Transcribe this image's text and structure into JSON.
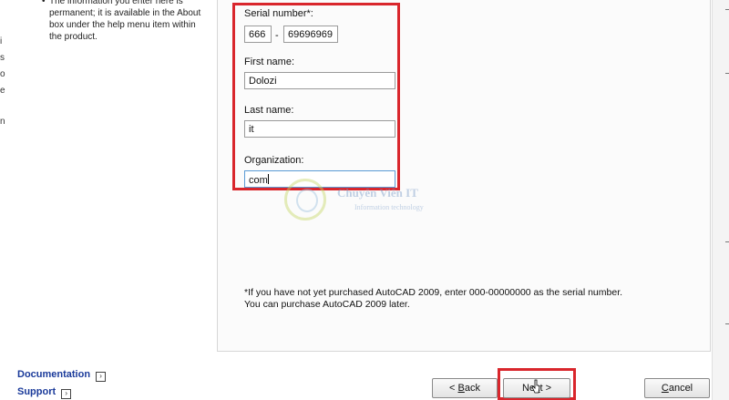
{
  "sidebar": {
    "note_text": "The information you enter here is permanent; it is available in the About box under the help menu item within the product."
  },
  "form": {
    "serial_label": "Serial number*:",
    "serial_prefix": "666",
    "serial_separator": "-",
    "serial_number": "69696969",
    "first_name_label": "First name:",
    "first_name": "Dolozi",
    "last_name_label": "Last name:",
    "last_name": "it",
    "organization_label": "Organization:",
    "organization": "com"
  },
  "watermark": {
    "name": "Chuyên Viên IT",
    "subtitle": "Information technology"
  },
  "footnote": "*If you have not yet purchased AutoCAD 2009, enter 000-00000000 as the serial number. You can purchase AutoCAD 2009 later.",
  "links": {
    "documentation": "Documentation",
    "support": "Support"
  },
  "buttons": {
    "back_prefix": "< ",
    "back_hotkey": "B",
    "back_rest": "ack",
    "next_prefix": "Ne",
    "next_hotkey": "x",
    "next_rest": "t >",
    "cancel_hotkey": "C",
    "cancel_rest": "ancel"
  },
  "colors": {
    "highlight_box": "#d9262c",
    "link": "#1a3a9a"
  }
}
